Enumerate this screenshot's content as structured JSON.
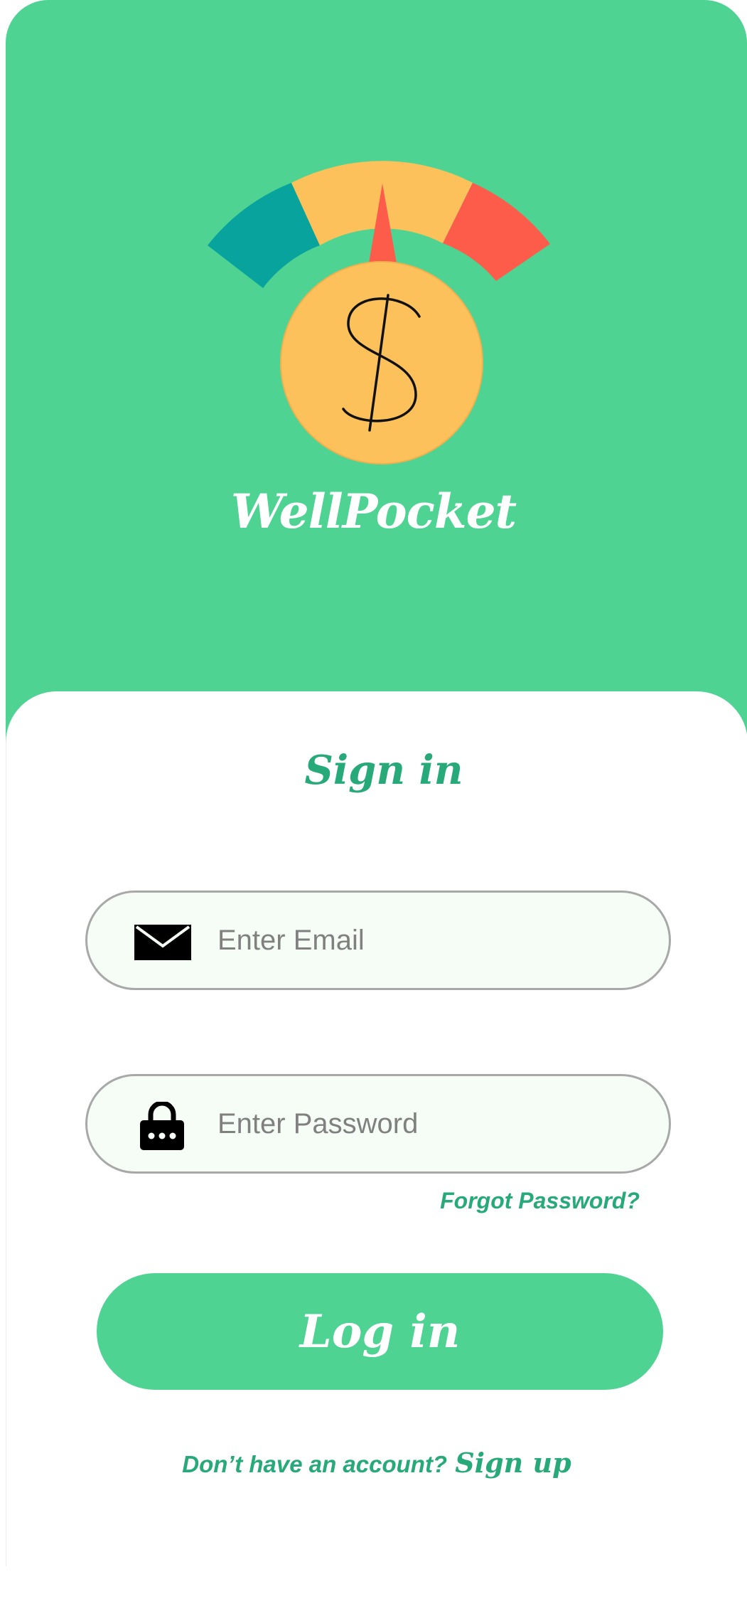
{
  "app": {
    "brand_name": "WellPocket",
    "icons": {
      "logo": "money-gauge-icon",
      "email": "envelope-icon",
      "password": "lock-icon"
    },
    "colors": {
      "primary_green": "#4ed393",
      "text_green": "#27a979",
      "gauge_teal": "#08a39d",
      "gauge_yellow": "#fcc15a",
      "gauge_red": "#fd5c4b"
    }
  },
  "signin": {
    "title": "Sign in",
    "email": {
      "value": "",
      "placeholder": "Enter Email"
    },
    "password": {
      "value": "",
      "placeholder": "Enter Password"
    },
    "forgot_password_label": "Forgot Password?",
    "login_label": "Log in",
    "signup_prompt": "Don’t have an account?",
    "signup_label": "Sign up"
  }
}
